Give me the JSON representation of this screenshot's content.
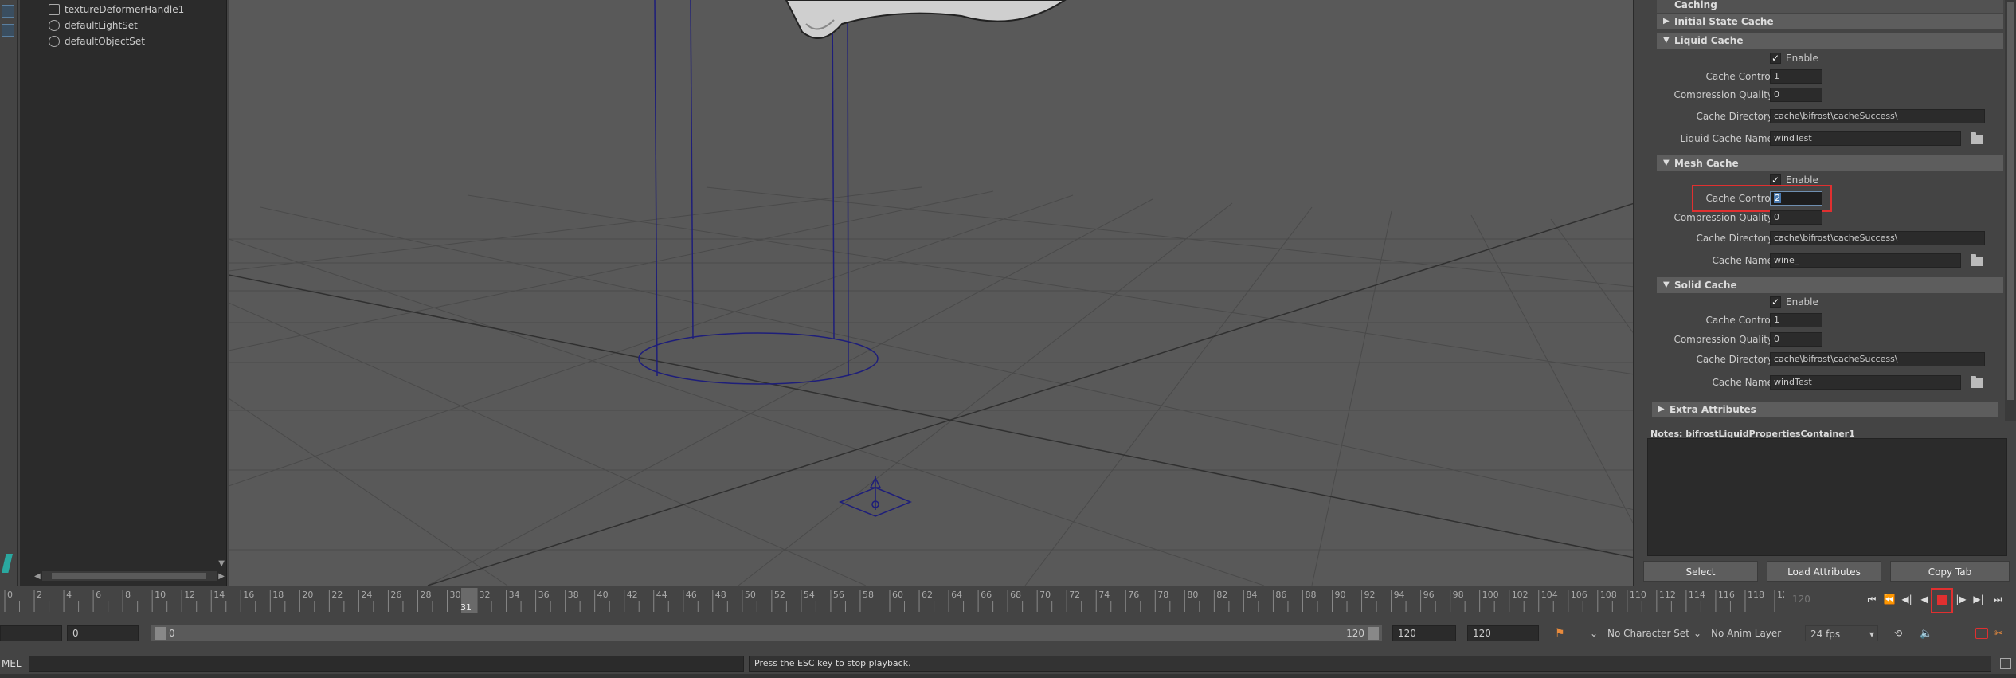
{
  "outliner": {
    "items": [
      {
        "label": "textureDeformerHandle1",
        "icon": "deformer-handle-icon"
      },
      {
        "label": "defaultLightSet",
        "icon": "set-icon"
      },
      {
        "label": "defaultObjectSet",
        "icon": "set-icon"
      }
    ]
  },
  "attribute_editor": {
    "caching_header": "Caching",
    "initial_state_cache": "Initial State Cache",
    "liquid_cache": {
      "header": "Liquid Cache",
      "enable_label": "Enable",
      "enable_checked": true,
      "cache_control_label": "Cache Control",
      "cache_control_value": "1",
      "compression_quality_label": "Compression Quality",
      "compression_quality_value": "0",
      "cache_directory_label": "Cache Directory",
      "cache_directory_value": "cache\\bifrost\\cacheSuccess\\",
      "cache_name_label": "Liquid Cache Name",
      "cache_name_value": "windTest"
    },
    "mesh_cache": {
      "header": "Mesh Cache",
      "enable_label": "Enable",
      "enable_checked": true,
      "cache_control_label": "Cache Control",
      "cache_control_value": "2",
      "compression_quality_label": "Compression Quality",
      "compression_quality_value": "0",
      "cache_directory_label": "Cache Directory",
      "cache_directory_value": "cache\\bifrost\\cacheSuccess\\",
      "cache_name_label": "Cache Name",
      "cache_name_value": "wine_"
    },
    "solid_cache": {
      "header": "Solid Cache",
      "enable_label": "Enable",
      "enable_checked": true,
      "cache_control_label": "Cache Control",
      "cache_control_value": "1",
      "compression_quality_label": "Compression Quality",
      "compression_quality_value": "0",
      "cache_directory_label": "Cache Directory",
      "cache_directory_value": "cache\\bifrost\\cacheSuccess\\",
      "cache_name_label": "Cache Name",
      "cache_name_value": "windTest"
    },
    "extra_attributes": "Extra Attributes",
    "notes_label": "Notes:  bifrostLiquidPropertiesContainer1",
    "buttons": {
      "select": "Select",
      "load_attributes": "Load Attributes",
      "copy_tab": "Copy Tab"
    }
  },
  "time_slider": {
    "ticks": [
      "0",
      "2",
      "4",
      "6",
      "8",
      "10",
      "12",
      "14",
      "16",
      "18",
      "20",
      "22",
      "24",
      "26",
      "28",
      "30",
      "32",
      "34",
      "36",
      "38",
      "40",
      "42",
      "44",
      "46",
      "48",
      "50",
      "52",
      "54",
      "56",
      "58",
      "60",
      "62",
      "64",
      "66",
      "68",
      "70",
      "72",
      "74",
      "76",
      "78",
      "80",
      "82",
      "84",
      "86",
      "88",
      "90",
      "92",
      "94",
      "96",
      "98",
      "100",
      "102",
      "104",
      "106",
      "108",
      "110",
      "112",
      "114",
      "116",
      "118",
      "120"
    ],
    "current_frame": "31",
    "end_field": "120"
  },
  "range_bar": {
    "start_field": "0",
    "anim_start": "0",
    "slider_start": "0",
    "slider_end": "120",
    "anim_end_1": "120",
    "anim_end_2": "120",
    "character_set": "No Character Set",
    "anim_layer": "No Anim Layer",
    "fps": "24 fps"
  },
  "command_line": {
    "mel_label": "MEL",
    "help_text": "Press the ESC key to stop playback."
  },
  "colors": {
    "highlight": "#e03030",
    "viewport_bg": "#595959",
    "wireframe": "#1e1e7a"
  }
}
